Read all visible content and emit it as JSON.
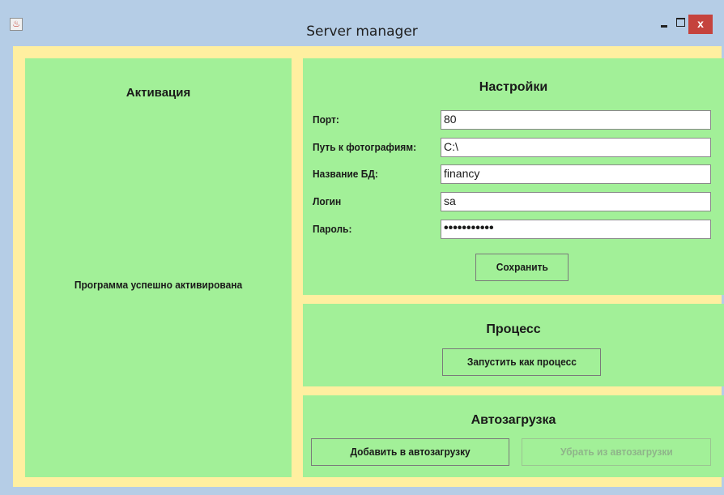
{
  "window": {
    "title": "Server manager",
    "icon": "java-cup-icon",
    "controls": {
      "minimize": "minimize-icon",
      "maximize": "maximize-icon",
      "close": "x"
    }
  },
  "activation": {
    "title": "Активация",
    "status": "Программа успешно активирована"
  },
  "settings": {
    "title": "Настройки",
    "fields": {
      "port": {
        "label": "Порт:",
        "value": "80"
      },
      "photo_path": {
        "label": "Путь к фотографиям:",
        "value": "C:\\"
      },
      "db_name": {
        "label": "Название БД:",
        "value": "financy"
      },
      "login": {
        "label": "Логин",
        "value": "sa"
      },
      "password": {
        "label": "Пароль:",
        "value": "•••••••••••"
      }
    },
    "save_label": "Сохранить"
  },
  "process": {
    "title": "Процесс",
    "run_label": "Запустить как процесс"
  },
  "autoload": {
    "title": "Автозагрузка",
    "add_label": "Добавить в автозагрузку",
    "remove_label": "Убрать из автозагрузки",
    "remove_enabled": false
  },
  "colors": {
    "title_bar": "#b5cde6",
    "content_bg": "#ffefa0",
    "panel_bg": "#a2f098",
    "close_button": "#c5433d"
  }
}
